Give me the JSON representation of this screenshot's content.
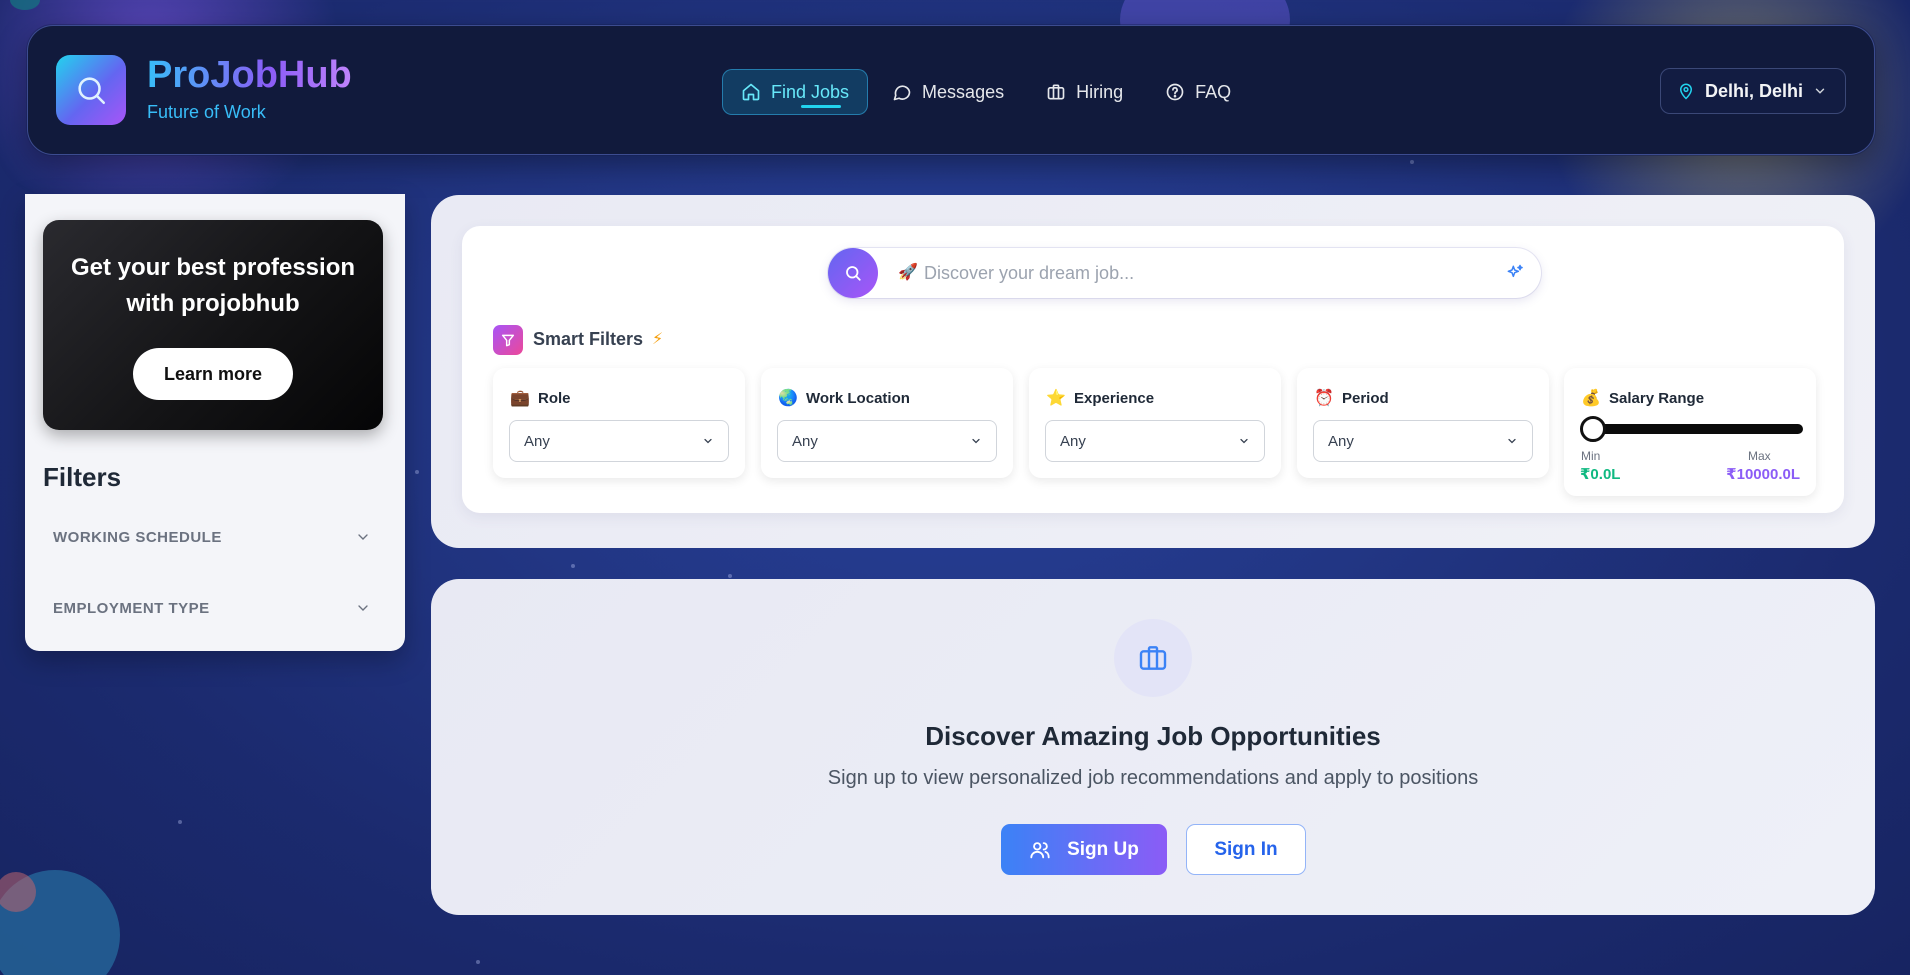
{
  "header": {
    "brand_name": "ProJobHub",
    "brand_tagline": "Future of Work",
    "nav": [
      {
        "label": "Find Jobs",
        "icon": "home-icon",
        "active": true
      },
      {
        "label": "Messages",
        "icon": "message-icon"
      },
      {
        "label": "Hiring",
        "icon": "briefcase-icon"
      },
      {
        "label": "FAQ",
        "icon": "help-icon"
      }
    ],
    "location": "Delhi, Delhi"
  },
  "sidebar": {
    "promo_title": "Get your best profession with projobhub",
    "promo_button": "Learn more",
    "filters_title": "Filters",
    "filter_sections": [
      {
        "label": "WORKING SCHEDULE"
      },
      {
        "label": "EMPLOYMENT TYPE"
      }
    ]
  },
  "search": {
    "emoji": "🚀",
    "placeholder": "Discover your dream job...",
    "smart_filters_label": "Smart Filters",
    "smart_filters_badge": "⚡"
  },
  "filters": [
    {
      "label": "Role",
      "emoji": "💼",
      "value": "Any"
    },
    {
      "label": "Work Location",
      "emoji": "🌏",
      "value": "Any"
    },
    {
      "label": "Experience",
      "emoji": "⭐",
      "value": "Any"
    },
    {
      "label": "Period",
      "emoji": "⏰",
      "value": "Any"
    }
  ],
  "salary": {
    "label": "Salary Range",
    "emoji": "💰",
    "min_label": "Min",
    "max_label": "Max",
    "min_value": "₹0.0L",
    "max_value": "₹10000.0L"
  },
  "discover": {
    "title": "Discover Amazing Job Opportunities",
    "subtitle": "Sign up to view personalized job recommendations and apply to positions",
    "signup_label": "Sign Up",
    "signin_label": "Sign In"
  },
  "colors": {
    "accent_cyan": "#22d3ee",
    "accent_purple": "#8b5cf6",
    "accent_blue": "#3b82f6",
    "salary_min": "#10b981",
    "page_bg": "#1f3079"
  }
}
